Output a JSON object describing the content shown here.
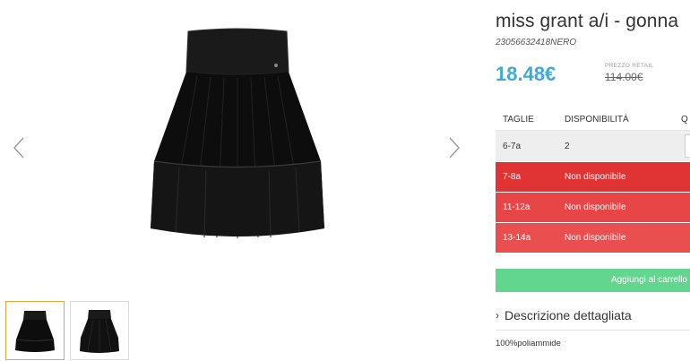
{
  "product": {
    "title": "miss grant a/i - gonna",
    "sku": "23056632418NERO",
    "price": "18.48€",
    "retail_label": "PREZZO RETAIL",
    "retail_price": "114.00€"
  },
  "sizes_table": {
    "headers": [
      "TAGLIE",
      "DISPONIBILITÀ",
      "Q"
    ],
    "rows": [
      {
        "size": "6-7a",
        "availability": "2",
        "status": "available"
      },
      {
        "size": "7-8a",
        "availability": "Non disponibile",
        "status": "unavailable"
      },
      {
        "size": "11-12a",
        "availability": "Non disponibile",
        "status": "unavailable"
      },
      {
        "size": "13-14a",
        "availability": "Non disponibile",
        "status": "unavailable"
      }
    ]
  },
  "cart_button_label": "Aggiungi al carrello",
  "description_toggle": "Descrizione dettagliata",
  "material": "100%poliammide",
  "colors": {
    "price": "#3fa9d9",
    "unavailable": "#e03434",
    "cart": "#62d58e",
    "thumb_active": "#e8a33d"
  },
  "icons": [
    "chevron-left-icon",
    "chevron-right-icon",
    "chevron-right-small-icon"
  ]
}
